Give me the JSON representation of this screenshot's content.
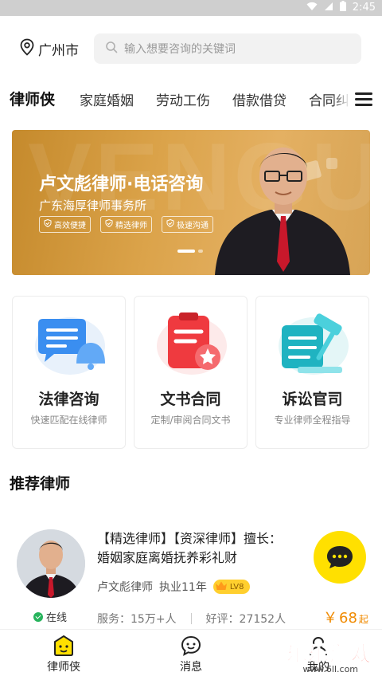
{
  "status_bar": {
    "time": "2:45",
    "icons": [
      "wifi-icon",
      "signal-icon",
      "battery-icon"
    ]
  },
  "location": {
    "city": "广州市",
    "icon": "location-pin-icon"
  },
  "search": {
    "placeholder": "输入想要咨询的关键词",
    "icon": "search-icon"
  },
  "tabs": [
    {
      "label": "律师侠",
      "active": true
    },
    {
      "label": "家庭婚姻",
      "active": false
    },
    {
      "label": "劳动工伤",
      "active": false
    },
    {
      "label": "借款借贷",
      "active": false
    },
    {
      "label": "合同纠",
      "active": false
    }
  ],
  "menu_icon": "hamburger-menu-icon",
  "banner": {
    "title": "卢文彪律师·电话咨询",
    "subtitle": "广东海厚律师事务所",
    "tags": [
      "高效便捷",
      "精选律师",
      "极速沟通"
    ],
    "active_slide": 1,
    "slide_count": 2
  },
  "services": [
    {
      "title": "法律咨询",
      "desc": "快速匹配在线律师",
      "icon": "chat-bubble-bell-icon"
    },
    {
      "title": "文书合同",
      "desc": "定制/审阅合同文书",
      "icon": "document-star-icon"
    },
    {
      "title": "诉讼官司",
      "desc": "专业律师全程指导",
      "icon": "gavel-book-icon"
    }
  ],
  "recommend": {
    "section_title": "推荐律师",
    "lawyer": {
      "headline": "【精选律师】【资深律师】擅长：婚姻家庭离婚抚养彩礼财",
      "name": "卢文彪律师",
      "experience": "执业11年",
      "level": "LV8",
      "status": "在线",
      "service_label": "服务：",
      "service_count": "15万+人",
      "rating_label": "好评：",
      "rating_count": "27152人",
      "price_symbol": "￥",
      "price": "68",
      "price_unit": "起"
    }
  },
  "bottom_nav": [
    {
      "label": "律师侠",
      "icon": "home-lawyer-icon",
      "active": true
    },
    {
      "label": "消息",
      "icon": "message-smile-icon",
      "active": false
    },
    {
      "label": "我的",
      "icon": "user-icon",
      "active": false
    }
  ],
  "watermark": {
    "text": "乐乐游戏",
    "url": "www.6ll.com"
  },
  "colors": {
    "accent_yellow": "#ffe33a",
    "price_orange": "#f08a00",
    "banner_gold": "#d9a04a",
    "online_green": "#27b35c"
  }
}
